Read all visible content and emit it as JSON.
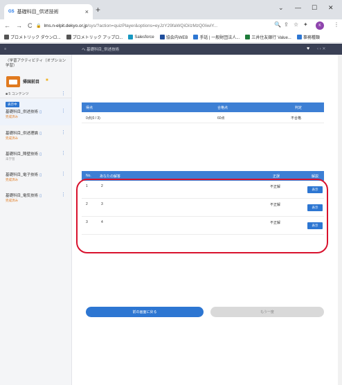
{
  "browser": {
    "tab_title": "基礎科目_供述技術",
    "tab_favicon": "GS",
    "new_tab": "+",
    "win_minimize": "—",
    "win_maximize": "☐",
    "win_close": "✕",
    "win_menu": "⌄",
    "url_host": "lms.n-elpit.dekyo.or.jp",
    "url_path": "/sys/?action=quizPlayer&options=eyJzY29faWQiOiIzMzQ0IiwiY...",
    "profile_initial": "K"
  },
  "bookmarks": [
    {
      "label": "プロメトリック ダウンロ...",
      "color": "#555555"
    },
    {
      "label": "プロメトリック アップロ...",
      "color": "#555555"
    },
    {
      "label": "Salesforce",
      "color": "#1798c1"
    },
    {
      "label": "協会内WEB",
      "color": "#1f4e9c"
    },
    {
      "label": "手話 | 一般財団法人...",
      "color": "#2d76d2"
    },
    {
      "label": "三井住友銀行 Value...",
      "color": "#1e7b3a"
    },
    {
      "label": "事務種類",
      "color": "#2d76d2"
    }
  ],
  "appbar": {
    "sidebar_header": "≡",
    "breadcrumb": "へ  基礎科目_供述技術",
    "favorite": "♥",
    "arrows": "‹  ›  ✕"
  },
  "sidebar": {
    "course_title": "〈学習アクティビティ（オプション学習）",
    "course_label": "帰国前目",
    "content_count": "■ 5 コンテンツ",
    "more": "⋮",
    "items": [
      {
        "badge": "表示中",
        "title": "基礎科目_供述技術",
        "status": "完成済み",
        "active": true
      },
      {
        "badge": "",
        "title": "基礎科目_供述理論",
        "status": "完成済み",
        "active": false
      },
      {
        "badge": "",
        "title": "基礎科目_障壁技術",
        "status": "未学習",
        "active": false
      },
      {
        "badge": "",
        "title": "基礎科目_電子技術",
        "status": "完成済み",
        "active": false
      },
      {
        "badge": "",
        "title": "基礎科目_電気技術",
        "status": "完成済み",
        "active": false
      }
    ]
  },
  "score": {
    "headers": {
      "score": "得点",
      "pass": "合格点",
      "judge": "判定"
    },
    "row": {
      "score": "0点(0 / 3)",
      "pass": "60点",
      "judge": "不合格"
    }
  },
  "results": {
    "headers": {
      "no": "No.",
      "answer": "あなたの解答",
      "correct": "正誤",
      "detail": "解説"
    },
    "rows": [
      {
        "no": "1",
        "answer": "2",
        "correct": "不正解",
        "button": "表示"
      },
      {
        "no": "2",
        "answer": "3",
        "correct": "不正解",
        "button": "表示"
      },
      {
        "no": "3",
        "answer": "4",
        "correct": "不正解",
        "button": "表示"
      }
    ]
  },
  "actions": {
    "back": "前の画面に戻る",
    "retry": "もう一度"
  },
  "colors": {
    "accent": "#2d76d2",
    "header_blue": "#3d7fd4",
    "highlight": "#d8112d",
    "appbar": "#3a4055"
  }
}
